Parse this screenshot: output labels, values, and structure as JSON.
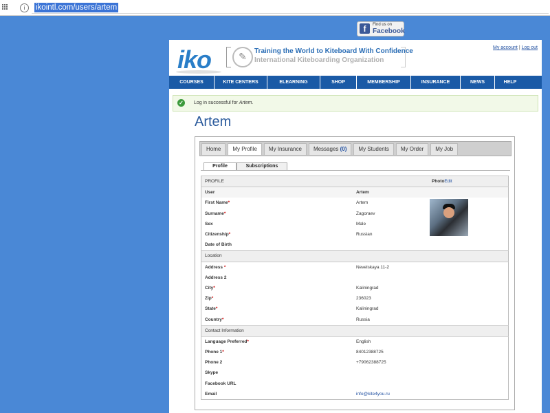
{
  "browser": {
    "url": "ikointl.com/users/artem"
  },
  "facebook": {
    "top": "Find us on",
    "name": "Facebook"
  },
  "header": {
    "logo": "iko",
    "tagline": "Training the World to Kiteboard With Confidence",
    "org": "International Kiteboarding Organization",
    "my_account": "My account",
    "separator": "|",
    "logout": "Log out"
  },
  "nav": [
    "COURSES",
    "KITE CENTERS",
    "ELEARNING",
    "SHOP",
    "MEMBERSHIP",
    "INSURANCE",
    "NEWS",
    "HELP"
  ],
  "message": {
    "prefix": "Log in successful for ",
    "user": "Artem",
    "suffix": "."
  },
  "user": {
    "name": "Artem"
  },
  "tabs": {
    "home": "Home",
    "profile": "My Profile",
    "insurance": "My Insurance",
    "messages": "Messages",
    "messages_count": "(0)",
    "students": "My Students",
    "order": "My Order",
    "job": "My Job"
  },
  "subtabs": {
    "profile": "Profile",
    "subscriptions": "Subscriptions"
  },
  "profile": {
    "section": "PROFILE",
    "photo_label": "Photo",
    "photo_edit": "Edit",
    "user_label": "User",
    "user_value": "Artem",
    "first_name": {
      "label": "First Name",
      "req": "*",
      "value": "Artem"
    },
    "surname": {
      "label": "Surname",
      "req": "*",
      "value": "Zagoraev"
    },
    "sex": {
      "label": "Sex",
      "value": "Male"
    },
    "citizenship": {
      "label": "Citizenship",
      "req": "*",
      "value": "Russian"
    },
    "dob": {
      "label": "Date of Birth",
      "value": ""
    }
  },
  "location": {
    "section": "Location",
    "address": {
      "label": "Address ",
      "req": "*",
      "value": "Nevelskaya 11-2"
    },
    "address2": {
      "label": "Address 2",
      "value": ""
    },
    "city": {
      "label": "City",
      "req": "*",
      "value": "Kaliningrad"
    },
    "zip": {
      "label": "Zip",
      "req": "*",
      "value": "236023"
    },
    "state": {
      "label": "State",
      "req": "*",
      "value": "Kaliningrad"
    },
    "country": {
      "label": "Country",
      "req": "*",
      "value": "Russia"
    }
  },
  "contact": {
    "section": "Contact Information",
    "language": {
      "label": "Language Preferred",
      "req": "*",
      "value": "English"
    },
    "phone1": {
      "label": "Phone 1",
      "req": "*",
      "value": "84012388725"
    },
    "phone2": {
      "label": "Phone 2",
      "value": "+79062388725"
    },
    "skype": {
      "label": "Skype",
      "value": ""
    },
    "facebook": {
      "label": "Facebook URL",
      "value": ""
    },
    "email": {
      "label": "Email",
      "value": "info@kite4you.ru"
    }
  },
  "colors": {
    "nav": "#1a5aa6",
    "brand": "#2a7ec8",
    "link": "#1f4fa0",
    "background": "#4a88d6"
  }
}
